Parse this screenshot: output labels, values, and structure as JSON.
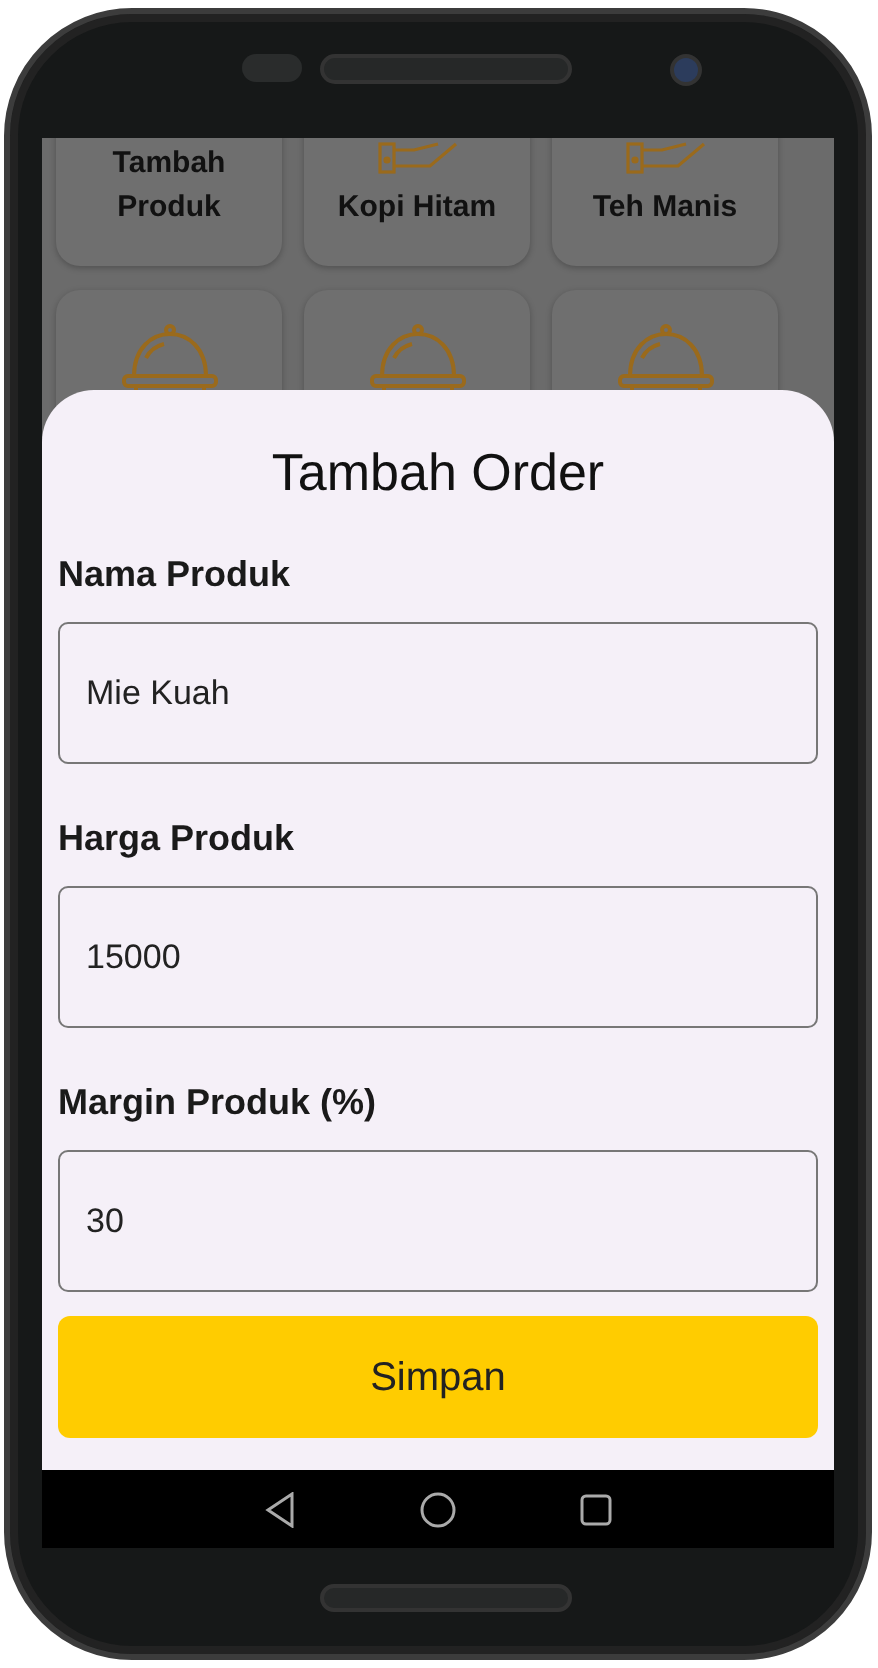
{
  "tiles": [
    {
      "label": "Tambah Produk",
      "kind": "text"
    },
    {
      "label": "Kopi Hitam",
      "kind": "hand"
    },
    {
      "label": "Teh Manis",
      "kind": "hand"
    },
    {
      "kind": "cloche"
    },
    {
      "kind": "cloche"
    },
    {
      "kind": "cloche"
    }
  ],
  "sheet": {
    "title": "Tambah Order",
    "fields": [
      {
        "label": "Nama Produk",
        "value": "Mie Kuah"
      },
      {
        "label": "Harga Produk",
        "value": "15000"
      },
      {
        "label": "Margin Produk (%)",
        "value": "30"
      }
    ],
    "button": "Simpan"
  }
}
